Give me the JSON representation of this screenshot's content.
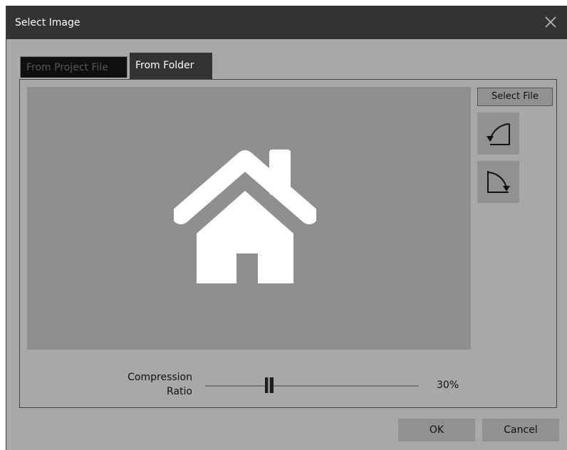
{
  "window": {
    "title": "Select Image"
  },
  "tabs": [
    {
      "label": "From Project File",
      "active": false
    },
    {
      "label": "From Folder",
      "active": true
    }
  ],
  "actions": {
    "select_file": "Select File"
  },
  "rotate": {
    "ccw_icon": "rotate-left-icon",
    "cw_icon": "rotate-right-icon"
  },
  "preview": {
    "icon": "house-icon"
  },
  "compression": {
    "label": "Compression Ratio",
    "value": "30%",
    "level": 0.3
  },
  "footer": {
    "ok": "OK",
    "cancel": "Cancel"
  },
  "colors": {
    "titlebar": "#333333",
    "dialog_bg": "#a8a8a8",
    "preview_bg": "#8f8f8f",
    "button_bg": "#919191"
  }
}
